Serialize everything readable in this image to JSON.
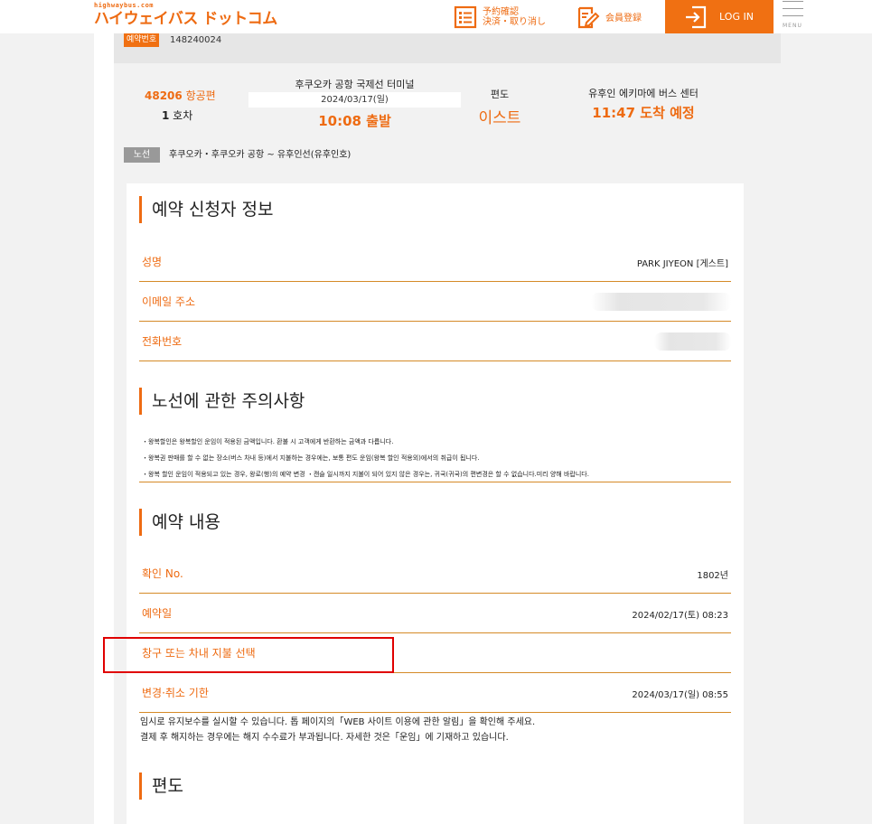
{
  "header": {
    "logo_small": "highwaybus.com",
    "logo_main": "ハイウェイバス ドットコム",
    "confirm_line1": "予約確認",
    "confirm_line2": "決済・取り消し",
    "member_label": "会員登録",
    "login_label": "LOG IN",
    "menu_label": "MENU",
    "accent_color": "#f07012"
  },
  "reservation": {
    "badge": "예약번호",
    "number": "148240024"
  },
  "trip": {
    "flight_no": "48206",
    "flight_suffix": " 항공편",
    "car_no": "1",
    "car_suffix": " 호차",
    "departure_name": "후쿠오카 공항 국제선 터미널",
    "departure_date": "2024/03/17(일)",
    "departure_time": "10:08 출발",
    "direction_label": "편도",
    "direction_value": "이스트",
    "arrival_name": "유후인 에키마에 버스 센터",
    "arrival_time": "11:47 도착 예정",
    "route_badge": "노선",
    "route_text": "후쿠오카・후쿠오카 공항 ~ 유후인선(유후인호)"
  },
  "applicant": {
    "title": "예약 신청자 정보",
    "name_label": "성명",
    "name_value": "PARK JIYEON [게스트]",
    "email_label": "이메일 주소",
    "phone_label": "전화번호"
  },
  "notice": {
    "title": "노선에 관한 주의사항",
    "lines": [
      "・왕복할인은 왕복할인 운임이 적용된 금액입니다.  환불 시 고객에게 반환하는 금액과 다릅니다.",
      "・왕복권 판매를 할 수 없는 장소(버스 차내 등)에서 지불하는 경우에는, 보통 편도 운임(왕복 할인 적용외)에서의 취급이 됩니다.",
      "・왕복 할인 운임이 적용되고 있는 경우, 왕로(행)의 예약 변경 ・캔슬 일시까지 지불이 되어 있지 않은 경우는, 귀국(귀국)의 편변경은 할 수 없습니다.미리 양해 바랍니다."
    ]
  },
  "booking": {
    "title": "예약 내용",
    "confirm_label": "확인 No.",
    "confirm_value": "1802년",
    "date_label": "예약일",
    "date_value": "2024/02/17(토) 08:23",
    "payment_label": "창구 또는 차내 지불 선택",
    "deadline_label": "변경·취소 기한",
    "deadline_value": "2024/03/17(일) 08:55",
    "maint_line1": "임시로 유지보수를 실시할 수 있습니다. 톱 페이지의「WEB 사이트 이용에 관한 알림」을 확인해 주세요.",
    "maint_line2": "결제 후 해지하는 경우에는 해지 수수료가 부과됩니다. 자세한 것은「운임」에 기재하고 있습니다."
  },
  "oneway": {
    "title": "편도"
  }
}
